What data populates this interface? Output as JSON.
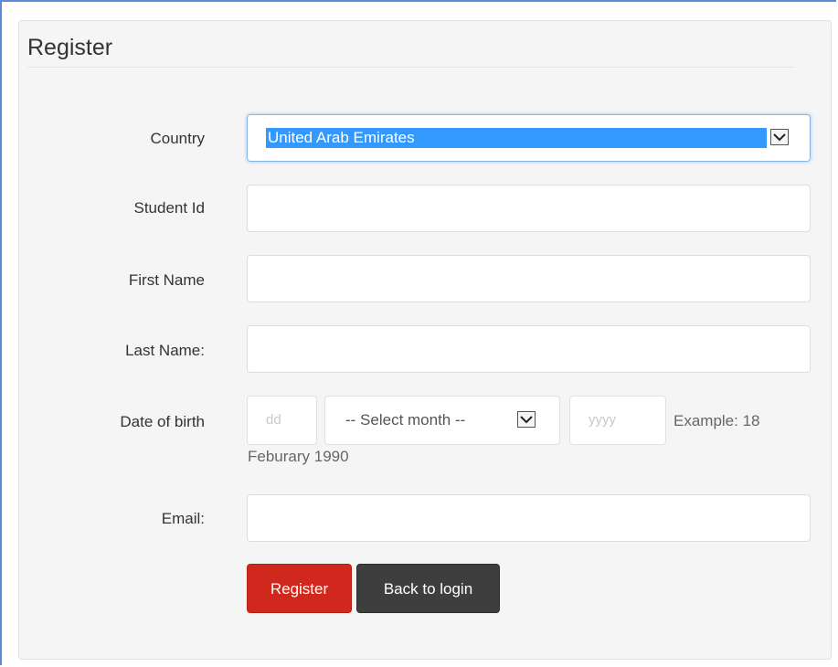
{
  "form": {
    "title": "Register",
    "country": {
      "label": "Country",
      "selected": "United Arab Emirates"
    },
    "student_id": {
      "label": "Student Id",
      "value": ""
    },
    "first_name": {
      "label": "First Name",
      "value": ""
    },
    "last_name": {
      "label": "Last Name:",
      "value": ""
    },
    "dob": {
      "label": "Date of birth",
      "day_placeholder": "dd",
      "month_selected": "-- Select month --",
      "year_placeholder": "yyyy",
      "help_line1": "Example: 18",
      "help_line2": "Feburary 1990"
    },
    "email": {
      "label": "Email:",
      "value": ""
    },
    "buttons": {
      "register": "Register",
      "back_to_login": "Back to login"
    }
  },
  "colors": {
    "register_button": "#d0281c",
    "back_button": "#3e3e3e",
    "selection_highlight": "#3399ff",
    "panel_background": "#f5f5f5"
  }
}
